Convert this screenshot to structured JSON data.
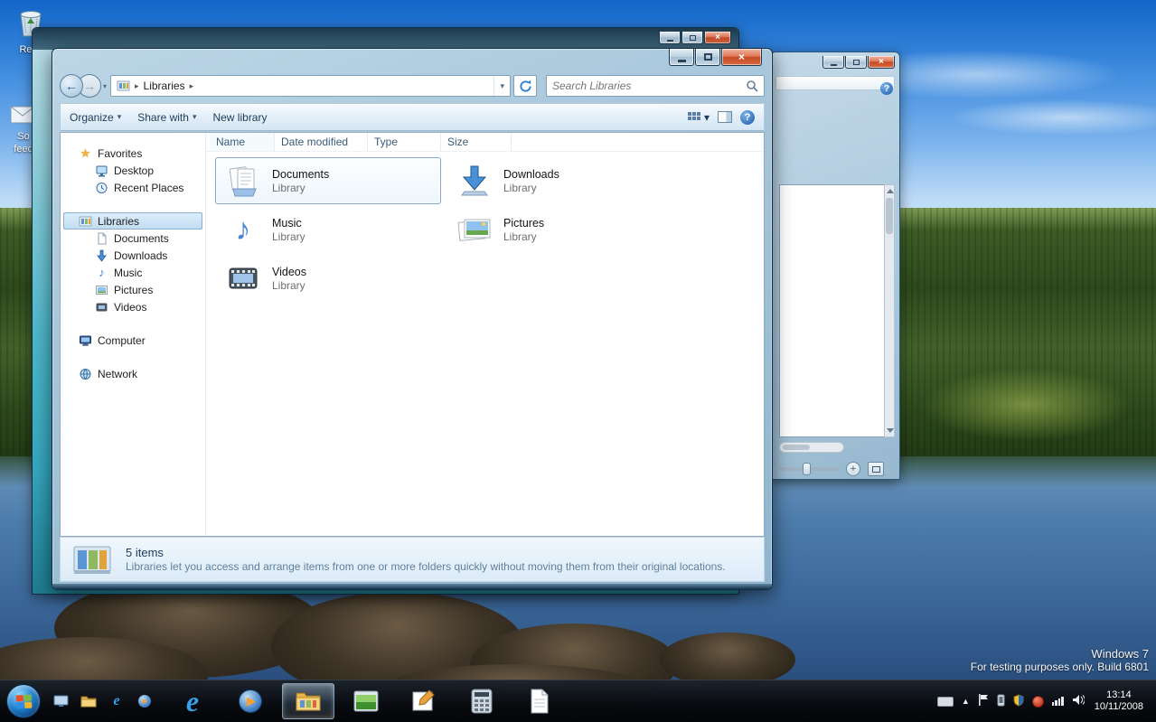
{
  "glyphs": {
    "close": "×",
    "dropdown": "▾",
    "crumb_arrow": "▸",
    "back_arrow": "←",
    "forward_arrow": "→",
    "star": "★",
    "note": "♪",
    "play": "▶",
    "expand_up": "▲",
    "help": "?",
    "e_logo": "e"
  },
  "desktop": {
    "recycle_bin_label": "Recy",
    "feeds_label_line1": "So",
    "feeds_label_line2": "feed",
    "watermark_line1": "Windows 7",
    "watermark_line2": "For testing purposes only. Build 6801"
  },
  "explorer": {
    "location": "Libraries",
    "search_placeholder": "Search Libraries",
    "commandbar": {
      "organize": "Organize",
      "share_with": "Share with",
      "new_library": "New library"
    },
    "columns": {
      "name": "Name",
      "date_modified": "Date modified",
      "type": "Type",
      "size": "Size"
    },
    "nav": {
      "favorites": "Favorites",
      "desktop": "Desktop",
      "recent_places": "Recent Places",
      "libraries": "Libraries",
      "documents": "Documents",
      "downloads": "Downloads",
      "music": "Music",
      "pictures": "Pictures",
      "videos": "Videos",
      "computer": "Computer",
      "network": "Network"
    },
    "files": [
      {
        "name": "Documents",
        "type": "Library"
      },
      {
        "name": "Downloads",
        "type": "Library"
      },
      {
        "name": "Music",
        "type": "Library"
      },
      {
        "name": "Pictures",
        "type": "Library"
      },
      {
        "name": "Videos",
        "type": "Library"
      }
    ],
    "details": {
      "count": "5 items",
      "description": "Libraries let you access and arrange items from one or more folders quickly without moving them from their original locations."
    }
  },
  "taskbar": {
    "time": "13:14",
    "date": "10/11/2008"
  },
  "colors": {
    "selection_border": "#84a7c8",
    "selection_fill": "#d6e9f8",
    "close_button": "#c64a26",
    "taskbar_bg": "#0a0e13",
    "accent_blue": "#2f7fd1"
  }
}
